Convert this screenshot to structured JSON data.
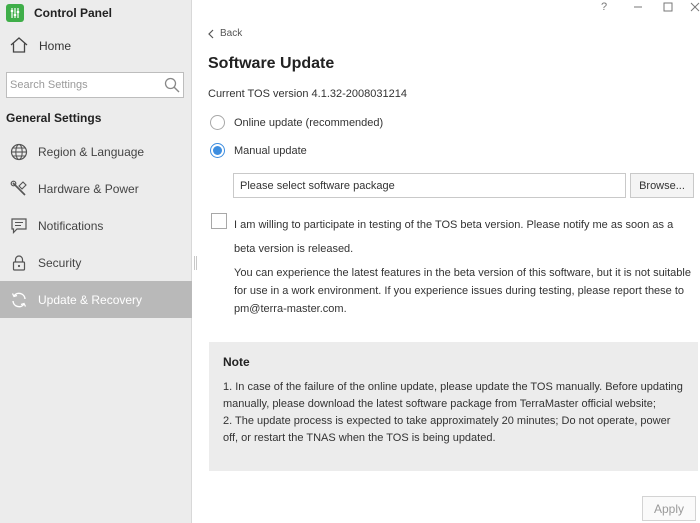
{
  "window": {
    "title": "Control Panel",
    "controls": {
      "help": "?"
    }
  },
  "sidebar": {
    "home_label": "Home",
    "search_placeholder": "Search Settings",
    "section_title": "General Settings",
    "items": [
      {
        "label": "Region & Language",
        "icon": "globe-icon"
      },
      {
        "label": "Hardware & Power",
        "icon": "tools-icon"
      },
      {
        "label": "Notifications",
        "icon": "chat-icon"
      },
      {
        "label": "Security",
        "icon": "lock-icon"
      },
      {
        "label": "Update & Recovery",
        "icon": "refresh-icon",
        "active": true
      }
    ]
  },
  "main": {
    "back_label": "Back",
    "title": "Software Update",
    "current_version": "Current TOS version 4.1.32-2008031214",
    "options": [
      {
        "label": "Online update (recommended)",
        "selected": false
      },
      {
        "label": "Manual update",
        "selected": true
      }
    ],
    "package_placeholder": "Please select software package",
    "browse_label": "Browse...",
    "beta_checkbox_label": "I am willing to participate in testing of the TOS beta version. Please notify me as soon as a beta version is released.",
    "beta_checked": false,
    "beta_description": "You can experience the latest features in the beta version of this software, but it is not suitable for use in a work environment. If you experience issues during testing, please report these to pm@terra-master.com.",
    "note": {
      "title": "Note",
      "line1": "1. In case of the failure of the online update, please update the TOS manually. Before updating manually, please download the latest software package from TerraMaster official website;",
      "line2": "2. The update process is expected to take approximately 20 minutes; Do not operate, power off, or restart the TNAS when the TOS is being updated."
    },
    "apply_label": "Apply"
  },
  "colors": {
    "accent": "#3d8ee0",
    "logo": "#3fae49",
    "active_nav": "#b9b9b9",
    "sidebar_bg": "#ececec"
  }
}
